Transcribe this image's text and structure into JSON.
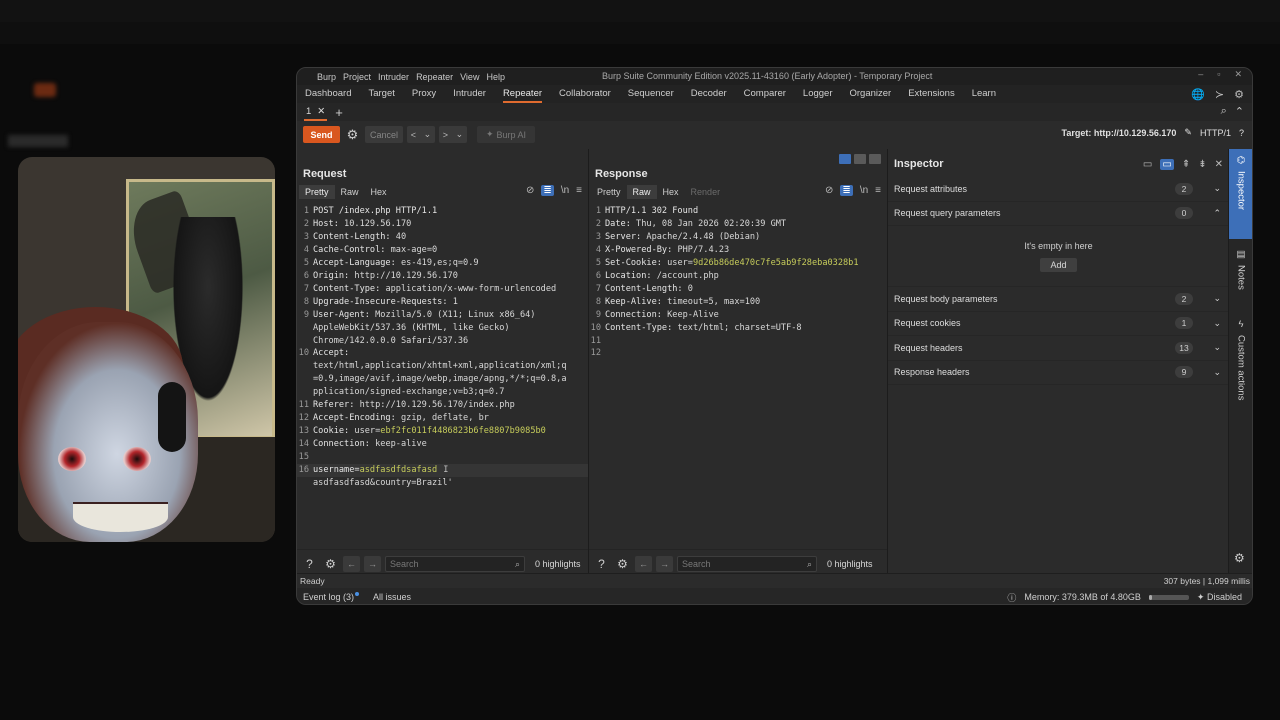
{
  "window": {
    "title": "Burp Suite Community Edition v2025.11-43160 (Early Adopter) - Temporary Project",
    "menus": [
      "Burp",
      "Project",
      "Intruder",
      "Repeater",
      "View",
      "Help"
    ],
    "controls": [
      "–",
      "▫",
      "✕"
    ]
  },
  "main_tabs": [
    "Dashboard",
    "Target",
    "Proxy",
    "Intruder",
    "Repeater",
    "Collaborator",
    "Sequencer",
    "Decoder",
    "Comparer",
    "Logger",
    "Organizer",
    "Extensions",
    "Learn"
  ],
  "active_main_tab": "Repeater",
  "repeater_tab": {
    "label": "1",
    "close": "✕",
    "add": "+"
  },
  "toolbar": {
    "send": "Send",
    "cancel": "Cancel",
    "back": "<",
    "forward": ">",
    "dropdown": "⌄",
    "burp_ai": "Burp AI",
    "target": "Target: http://10.129.56.170",
    "protocol": "HTTP/1"
  },
  "request": {
    "title": "Request",
    "view_tabs": [
      "Pretty",
      "Raw",
      "Hex"
    ],
    "active_view": "Pretty",
    "icons": [
      "eye-off",
      "wrap",
      "\\n",
      "≡"
    ],
    "lines": [
      {
        "n": "1",
        "parts": [
          {
            "t": "POST /index.php HTTP/1.1",
            "c": "k"
          }
        ]
      },
      {
        "n": "2",
        "parts": [
          {
            "t": "Host: ",
            "c": "k"
          },
          {
            "t": "10.129.56.170",
            "c": "v"
          }
        ]
      },
      {
        "n": "3",
        "parts": [
          {
            "t": "Content-Length: ",
            "c": "k"
          },
          {
            "t": "40",
            "c": "v"
          }
        ]
      },
      {
        "n": "4",
        "parts": [
          {
            "t": "Cache-Control: ",
            "c": "k"
          },
          {
            "t": "max-age=0",
            "c": "v"
          }
        ]
      },
      {
        "n": "5",
        "parts": [
          {
            "t": "Accept-Language: ",
            "c": "k"
          },
          {
            "t": "es-419,es;q=0.9",
            "c": "v"
          }
        ]
      },
      {
        "n": "6",
        "parts": [
          {
            "t": "Origin: ",
            "c": "k"
          },
          {
            "t": "http://10.129.56.170",
            "c": "v"
          }
        ]
      },
      {
        "n": "7",
        "parts": [
          {
            "t": "Content-Type: ",
            "c": "k"
          },
          {
            "t": "application/x-www-form-urlencoded",
            "c": "v"
          }
        ]
      },
      {
        "n": "8",
        "parts": [
          {
            "t": "Upgrade-Insecure-Requests: ",
            "c": "k"
          },
          {
            "t": "1",
            "c": "v"
          }
        ]
      },
      {
        "n": "9",
        "parts": [
          {
            "t": "User-Agent: ",
            "c": "k"
          },
          {
            "t": "Mozilla/5.0 (X11; Linux x86_64)",
            "c": "v"
          }
        ]
      },
      {
        "n": "",
        "parts": [
          {
            "t": "AppleWebKit/537.36 (KHTML, like Gecko)",
            "c": "v"
          }
        ]
      },
      {
        "n": "",
        "parts": [
          {
            "t": "Chrome/142.0.0.0 Safari/537.36",
            "c": "v"
          }
        ]
      },
      {
        "n": "10",
        "parts": [
          {
            "t": "Accept: ",
            "c": "k"
          }
        ]
      },
      {
        "n": "",
        "parts": [
          {
            "t": "text/html,application/xhtml+xml,application/xml;q",
            "c": "v"
          }
        ]
      },
      {
        "n": "",
        "parts": [
          {
            "t": "=0.9,image/avif,image/webp,image/apng,*/*;q=0.8,a",
            "c": "v"
          }
        ]
      },
      {
        "n": "",
        "parts": [
          {
            "t": "pplication/signed-exchange;v=b3;q=0.7",
            "c": "v"
          }
        ]
      },
      {
        "n": "11",
        "parts": [
          {
            "t": "Referer: ",
            "c": "k"
          },
          {
            "t": "http://10.129.56.170/index.php",
            "c": "v"
          }
        ]
      },
      {
        "n": "12",
        "parts": [
          {
            "t": "Accept-Encoding: ",
            "c": "k"
          },
          {
            "t": "gzip, deflate, br",
            "c": "v"
          }
        ]
      },
      {
        "n": "13",
        "parts": [
          {
            "t": "Cookie: ",
            "c": "k"
          },
          {
            "t": "user=",
            "c": "v"
          },
          {
            "t": "ebf2fc011f4486823b6fe8807b9085b0",
            "c": "hl"
          }
        ]
      },
      {
        "n": "14",
        "parts": [
          {
            "t": "Connection: ",
            "c": "k"
          },
          {
            "t": "keep-alive",
            "c": "v"
          }
        ]
      },
      {
        "n": "15",
        "parts": []
      },
      {
        "n": "16",
        "parts": [
          {
            "t": "username=",
            "c": "k"
          },
          {
            "t": "asdfasdfdsafasd",
            "c": "hl"
          }
        ],
        "cursor": true
      },
      {
        "n": "",
        "parts": [
          {
            "t": "asdfasdfasd&country=Brazil'",
            "c": "v"
          }
        ]
      }
    ]
  },
  "response": {
    "title": "Response",
    "view_tabs": [
      "Pretty",
      "Raw",
      "Hex",
      "Render"
    ],
    "active_view": "Raw",
    "lines": [
      {
        "n": "1",
        "parts": [
          {
            "t": "HTTP/1.1 302 Found",
            "c": "k"
          }
        ]
      },
      {
        "n": "2",
        "parts": [
          {
            "t": "Date: ",
            "c": "k"
          },
          {
            "t": "Thu, 08 Jan 2026 02:20:39 GMT",
            "c": "v"
          }
        ]
      },
      {
        "n": "3",
        "parts": [
          {
            "t": "Server: ",
            "c": "k"
          },
          {
            "t": "Apache/2.4.48 (Debian)",
            "c": "v"
          }
        ]
      },
      {
        "n": "4",
        "parts": [
          {
            "t": "X-Powered-By: ",
            "c": "k"
          },
          {
            "t": "PHP/7.4.23",
            "c": "v"
          }
        ]
      },
      {
        "n": "5",
        "parts": [
          {
            "t": "Set-Cookie: ",
            "c": "k"
          },
          {
            "t": "user=",
            "c": "v"
          },
          {
            "t": "9d26b86de470c7fe5ab9f28eba0328b1",
            "c": "hl"
          }
        ]
      },
      {
        "n": "6",
        "parts": [
          {
            "t": "Location: ",
            "c": "k"
          },
          {
            "t": "/account.php",
            "c": "v"
          }
        ]
      },
      {
        "n": "7",
        "parts": [
          {
            "t": "Content-Length: ",
            "c": "k"
          },
          {
            "t": "0",
            "c": "v"
          }
        ]
      },
      {
        "n": "8",
        "parts": [
          {
            "t": "Keep-Alive: ",
            "c": "k"
          },
          {
            "t": "timeout=5, max=100",
            "c": "v"
          }
        ]
      },
      {
        "n": "9",
        "parts": [
          {
            "t": "Connection: ",
            "c": "k"
          },
          {
            "t": "Keep-Alive",
            "c": "v"
          }
        ]
      },
      {
        "n": "10",
        "parts": [
          {
            "t": "Content-Type: ",
            "c": "k"
          },
          {
            "t": "text/html; charset=UTF-8",
            "c": "v"
          }
        ]
      },
      {
        "n": "11",
        "parts": []
      },
      {
        "n": "12",
        "parts": []
      }
    ]
  },
  "inspector": {
    "title": "Inspector",
    "rows": [
      {
        "label": "Request attributes",
        "count": "2",
        "chevron": "⌄"
      },
      {
        "label": "Request query parameters",
        "count": "0",
        "chevron": "⌃",
        "empty": true
      },
      {
        "label": "Request body parameters",
        "count": "2",
        "chevron": "⌄"
      },
      {
        "label": "Request cookies",
        "count": "1",
        "chevron": "⌄"
      },
      {
        "label": "Request headers",
        "count": "13",
        "chevron": "⌄"
      },
      {
        "label": "Response headers",
        "count": "9",
        "chevron": "⌄"
      }
    ],
    "empty_text": "It's empty in here",
    "add_label": "Add"
  },
  "sidebar": {
    "inspector": "Inspector",
    "notes": "Notes",
    "custom_actions": "Custom actions"
  },
  "search": {
    "placeholder": "Search",
    "req_highlights": "0 highlights",
    "resp_highlights": "0 highlights"
  },
  "status": {
    "left": "Ready",
    "right": "307 bytes | 1,099 millis"
  },
  "bottom": {
    "event_log": "Event log (3)",
    "all_issues": "All issues",
    "memory": "Memory: 379.3MB of 4.80GB",
    "memory_fraction": 0.08,
    "disabled": "Disabled"
  },
  "colors": {
    "accent": "#e06b2f",
    "send": "#d9571f",
    "highlight": "#c6cc5b",
    "select_blue": "#3d6fb8"
  }
}
